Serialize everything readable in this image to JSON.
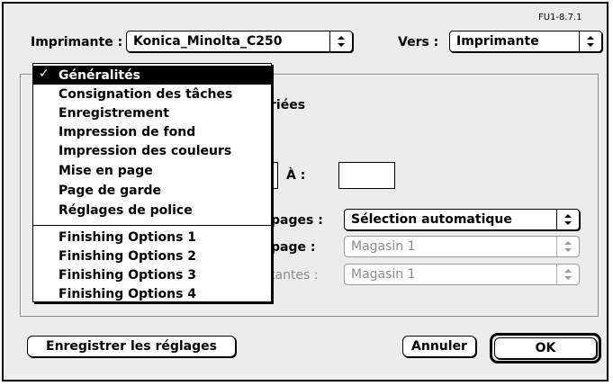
{
  "version": "FU1-8.7.1",
  "printer": {
    "label": "Imprimante :",
    "value": "Konica_Minolta_C250"
  },
  "destination": {
    "label": "Vers :",
    "value": "Imprimante"
  },
  "partial_text": {
    "series": "riées",
    "to_label": "À :",
    "pages": "pages :",
    "page": "page :",
    "remaining": "tantes :"
  },
  "paper_source": {
    "first_page": "Sélection automatique",
    "page": "Magasin 1",
    "remaining": "Magasin 1"
  },
  "menu": {
    "checkmark": "✓",
    "items": [
      "Généralités",
      "Consignation des tâches",
      "Enregistrement",
      "Impression de fond",
      "Impression des couleurs",
      "Mise en page",
      "Page de garde",
      "Réglages de police",
      "Finishing Options 1",
      "Finishing Options 2",
      "Finishing Options 3",
      "Finishing Options 4"
    ]
  },
  "buttons": {
    "save": "Enregistrer les réglages",
    "cancel": "Annuler",
    "ok": "OK"
  }
}
